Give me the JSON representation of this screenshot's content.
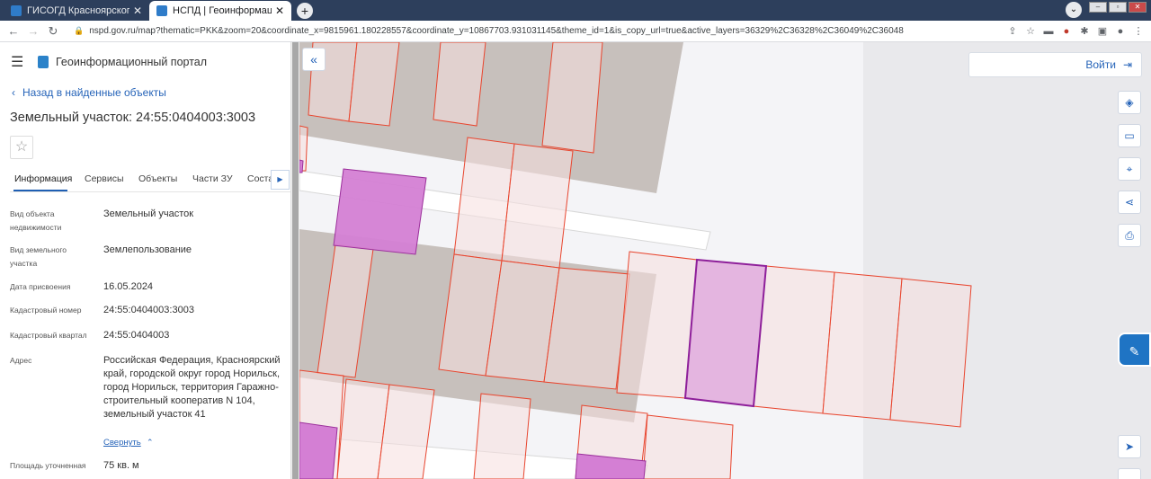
{
  "browser": {
    "tabs": [
      {
        "label": "ГИСОГД Красноярского края",
        "active": false
      },
      {
        "label": "НСПД | Геоинформационный п",
        "active": true
      }
    ],
    "url": "nspd.gov.ru/map?thematic=PKK&zoom=20&coordinate_x=9815961.180228557&coordinate_y=10867703.931031145&theme_id=1&is_copy_url=true&active_layers=36329%2C36328%2C36049%2C36048"
  },
  "sidebar": {
    "portal_name": "Геоинформационный портал",
    "back_link": "Назад в найденные объекты",
    "title": "Земельный участок: 24:55:0404003:3003",
    "tabs": [
      "Информация",
      "Сервисы",
      "Объекты",
      "Части ЗУ",
      "Соста"
    ],
    "properties": [
      {
        "label": "Вид объекта недвижимости",
        "value": "Земельный участок"
      },
      {
        "label": "Вид земельного участка",
        "value": "Землепользование"
      },
      {
        "label": "Дата присвоения",
        "value": "16.05.2024"
      },
      {
        "label": "Кадастровый номер",
        "value": "24:55:0404003:3003"
      },
      {
        "label": "Кадастровый квартал",
        "value": "24:55:0404003"
      },
      {
        "label": "Адрес",
        "value": "Российская Федерация, Красноярский край, городской округ город Норильск, город Норильск, территория Гаражно-строительный кооператив N 104, земельный участок 41"
      },
      {
        "label": "Площадь уточненная",
        "value": "75 кв. м"
      }
    ],
    "collapse_link": "Свернуть"
  },
  "map": {
    "login_label": "Войти",
    "tools": [
      "layers-icon",
      "ruler-icon",
      "select-area-icon",
      "share-icon",
      "print-icon",
      "locate-icon"
    ],
    "colors": {
      "building": "#c9c2be",
      "parcel_fill": "#f6dede",
      "parcel_stroke": "#e8452e",
      "selected": "#d47fd4",
      "road": "#ffffff"
    }
  }
}
